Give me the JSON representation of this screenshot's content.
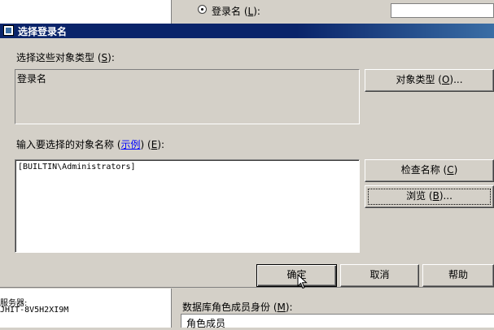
{
  "background": {
    "login_radio_label": "登录名",
    "login_radio_hotkey": "L",
    "server_label": "服务器:",
    "server_name": "JHIT-8V5H2XI9M",
    "role_membership_label": "数据库角色成员身份",
    "role_membership_hotkey": "M",
    "role_column_header": "角色成员"
  },
  "dialog": {
    "title": "选择登录名",
    "object_types_label": "选择这些对象类型",
    "object_types_hotkey": "S",
    "object_types_value": "登录名",
    "object_types_button": "对象类型",
    "object_types_button_hotkey": "O",
    "object_names_label": "输入要选择的对象名称",
    "examples_link": "示例",
    "object_names_hotkey": "E",
    "object_names_value": "[BUILTIN\\Administrators]",
    "check_names_button": "检查名称",
    "check_names_hotkey": "C",
    "browse_button": "浏览",
    "browse_hotkey": "B",
    "ok_button": "确定",
    "cancel_button": "取消",
    "help_button": "帮助"
  }
}
